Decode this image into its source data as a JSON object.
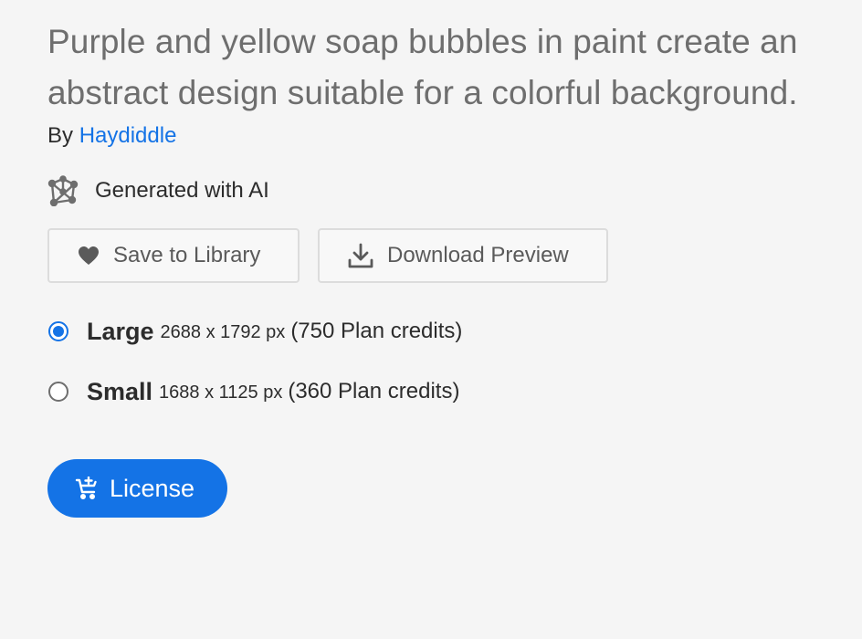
{
  "asset": {
    "title": "Purple and yellow soap bubbles in paint create an abstract design suitable for a colorful background.",
    "by_prefix": "By",
    "author": "Haydiddle"
  },
  "ai_badge": {
    "icon": "ai-network-icon",
    "label": "Generated with AI"
  },
  "actions": {
    "save_label": "Save to Library",
    "save_icon": "heart-icon",
    "download_label": "Download Preview",
    "download_icon": "download-icon"
  },
  "sizes": [
    {
      "name": "Large",
      "dimensions": "2688 x 1792 px",
      "credits": "(750 Plan credits)",
      "selected": true
    },
    {
      "name": "Small",
      "dimensions": "1688 x 1125 px",
      "credits": "(360 Plan credits)",
      "selected": false
    }
  ],
  "license": {
    "label": "License",
    "icon": "cart-add-icon"
  },
  "colors": {
    "accent": "#1473e6",
    "background": "#f5f5f5"
  }
}
